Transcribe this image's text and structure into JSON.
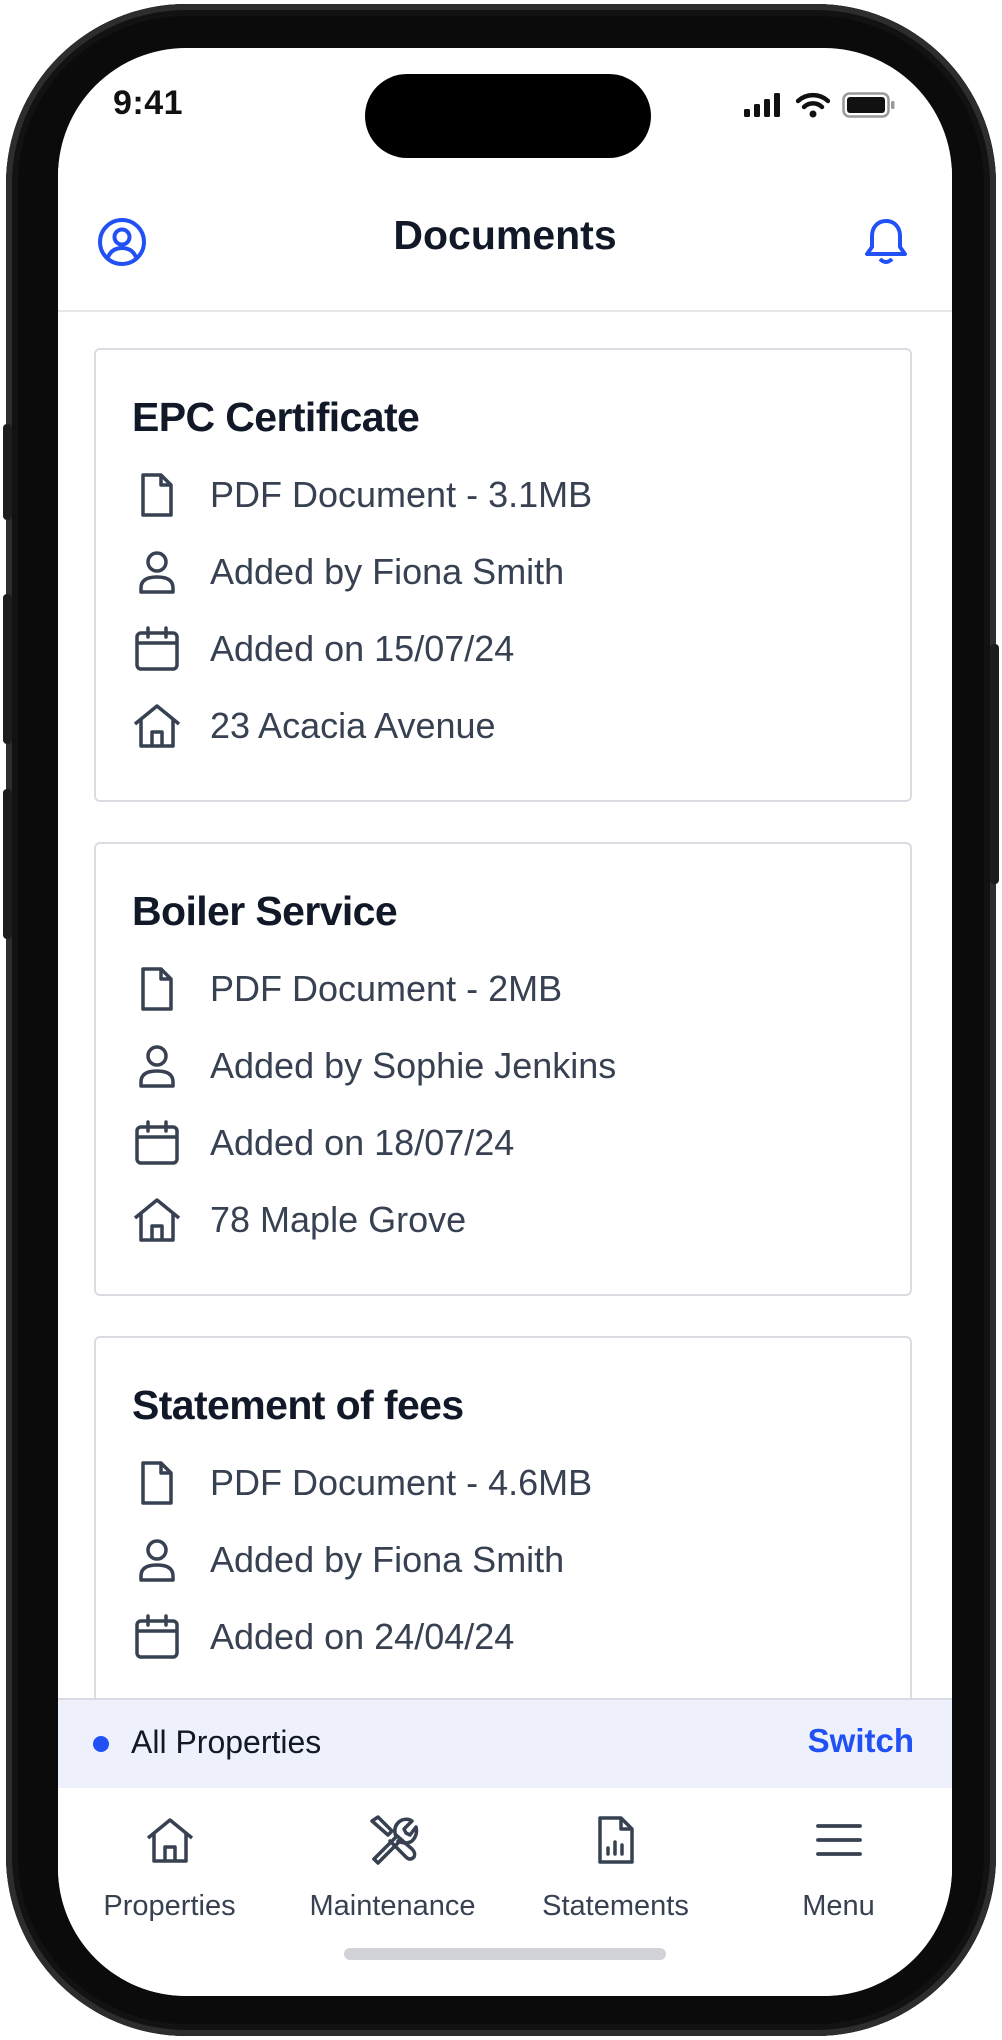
{
  "status_bar": {
    "time": "9:41"
  },
  "header": {
    "title": "Documents",
    "profile_icon": "user-circle-icon",
    "notifications_icon": "bell-icon"
  },
  "documents": [
    {
      "title": "EPC Certificate",
      "file": "PDF Document - 3.1MB",
      "added_by": "Added by Fiona Smith",
      "added_on": "Added on 15/07/24",
      "property": "23 Acacia Avenue"
    },
    {
      "title": "Boiler Service",
      "file": "PDF Document - 2MB",
      "added_by": "Added by Sophie Jenkins",
      "added_on": "Added on 18/07/24",
      "property": "78 Maple Grove"
    },
    {
      "title": "Statement of fees",
      "file": "PDF Document - 4.6MB",
      "added_by": "Added by Fiona Smith",
      "added_on": "Added on 24/04/24",
      "property": ""
    }
  ],
  "property_bar": {
    "label": "All Properties",
    "switch_label": "Switch"
  },
  "tabs": [
    {
      "label": "Properties",
      "icon": "home-icon"
    },
    {
      "label": "Maintenance",
      "icon": "tools-icon"
    },
    {
      "label": "Statements",
      "icon": "chart-document-icon"
    },
    {
      "label": "Menu",
      "icon": "menu-icon"
    }
  ],
  "colors": {
    "accent": "#2151f5",
    "text_primary": "#111827",
    "text_secondary": "#374151",
    "card_border": "#d9dce1",
    "property_bar_bg": "#eef1fb"
  }
}
